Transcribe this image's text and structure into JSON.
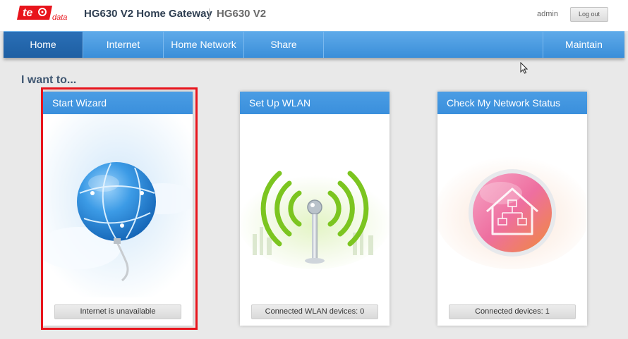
{
  "brand": {
    "logo_text": "te",
    "logo_sub": "data",
    "logo_color": "#e8141c"
  },
  "header": {
    "product_title": "HG630 V2 Home Gateway",
    "model": "HG630 V2",
    "user": "admin",
    "logout_label": "Log out"
  },
  "nav": {
    "items": [
      {
        "label": "Home",
        "active": true
      },
      {
        "label": "Internet"
      },
      {
        "label": "Home Network"
      },
      {
        "label": "Share"
      }
    ],
    "maintain": "Maintain"
  },
  "main": {
    "heading": "I want to...",
    "cards": [
      {
        "title": "Start Wizard",
        "icon": "globe-icon",
        "status": "Internet is unavailable",
        "selected": true
      },
      {
        "title": "Set Up WLAN",
        "icon": "wifi-antenna-icon",
        "status": "Connected WLAN devices: 0"
      },
      {
        "title": "Check My Network Status",
        "icon": "home-network-icon",
        "status": "Connected devices: 1"
      }
    ]
  },
  "colors": {
    "nav_blue": "#3a8ed9",
    "nav_active": "#1e5fa3",
    "highlight_red": "#e8141c",
    "wifi_green": "#7cc520",
    "house_pink": "#ee6fa0"
  }
}
